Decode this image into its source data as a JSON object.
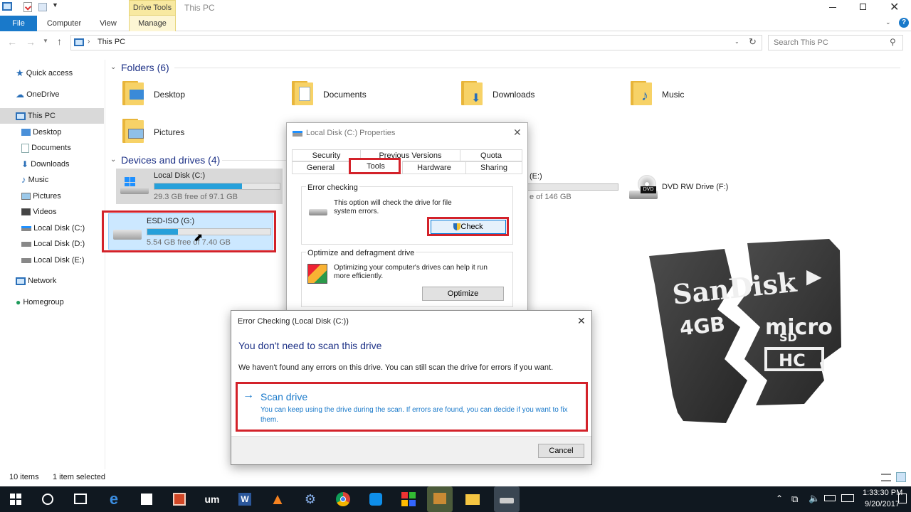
{
  "window": {
    "title": "This PC",
    "drive_tools": "Drive Tools"
  },
  "ribbon": {
    "tabs": [
      "File",
      "Computer",
      "View",
      "Manage"
    ]
  },
  "address": {
    "path": "This PC",
    "search_placeholder": "Search This PC"
  },
  "nav": {
    "items": [
      "Quick access",
      "OneDrive",
      "This PC",
      "Desktop",
      "Documents",
      "Downloads",
      "Music",
      "Pictures",
      "Videos",
      "Local Disk (C:)",
      "Local Disk (D:)",
      "Local Disk (E:)",
      "Network",
      "Homegroup"
    ]
  },
  "folders": {
    "header": "Folders (6)",
    "items": [
      "Desktop",
      "Documents",
      "Downloads",
      "Music",
      "Pictures"
    ]
  },
  "drives": {
    "header": "Devices and drives (4)",
    "items": [
      {
        "name": "Local Disk (C:)",
        "free": "29.3 GB free of 97.1 GB",
        "used_fraction": 0.7
      },
      {
        "name": "ESD-ISO (G:)",
        "free": "5.54 GB free of 7.40 GB",
        "used_fraction": 0.25
      },
      {
        "name": "(E:)",
        "free": "e of 146 GB",
        "used_fraction": 0.0
      },
      {
        "name": "DVD RW Drive (F:)"
      }
    ]
  },
  "status": {
    "items_count": "10 items",
    "selected": "1 item selected"
  },
  "properties": {
    "title": "Local Disk (C:) Properties",
    "tabs_row1": [
      "Security",
      "Previous Versions",
      "Quota"
    ],
    "tabs_row2": [
      "General",
      "Tools",
      "Hardware",
      "Sharing"
    ],
    "error_group": "Error checking",
    "error_text": "This option will check the drive for file system errors.",
    "check_label": "Check",
    "optimize_group": "Optimize and defragment drive",
    "optimize_text": "Optimizing your computer's drives can help it run more efficiently.",
    "optimize_label": "Optimize"
  },
  "errordlg": {
    "title": "Error Checking (Local Disk (C:))",
    "heading": "You don't need to scan this drive",
    "message": "We haven't found any errors on this drive. You can still scan the drive for errors if you want.",
    "scan_title": "Scan drive",
    "scan_desc": "You can keep using the drive during the scan. If errors are found, you can decide if you want to fix them.",
    "cancel_label": "Cancel"
  },
  "sdcard": {
    "brand": "SanDisk",
    "capacity": "4GB",
    "micro": "micro",
    "sd": "SD",
    "hc": "HC"
  },
  "taskbar": {
    "time": "1:33:30 PM",
    "date": "9/20/2017"
  },
  "colors": {
    "accent": "#1979ca",
    "highlight": "#d3222a",
    "bar_fill": "#26a0da"
  }
}
